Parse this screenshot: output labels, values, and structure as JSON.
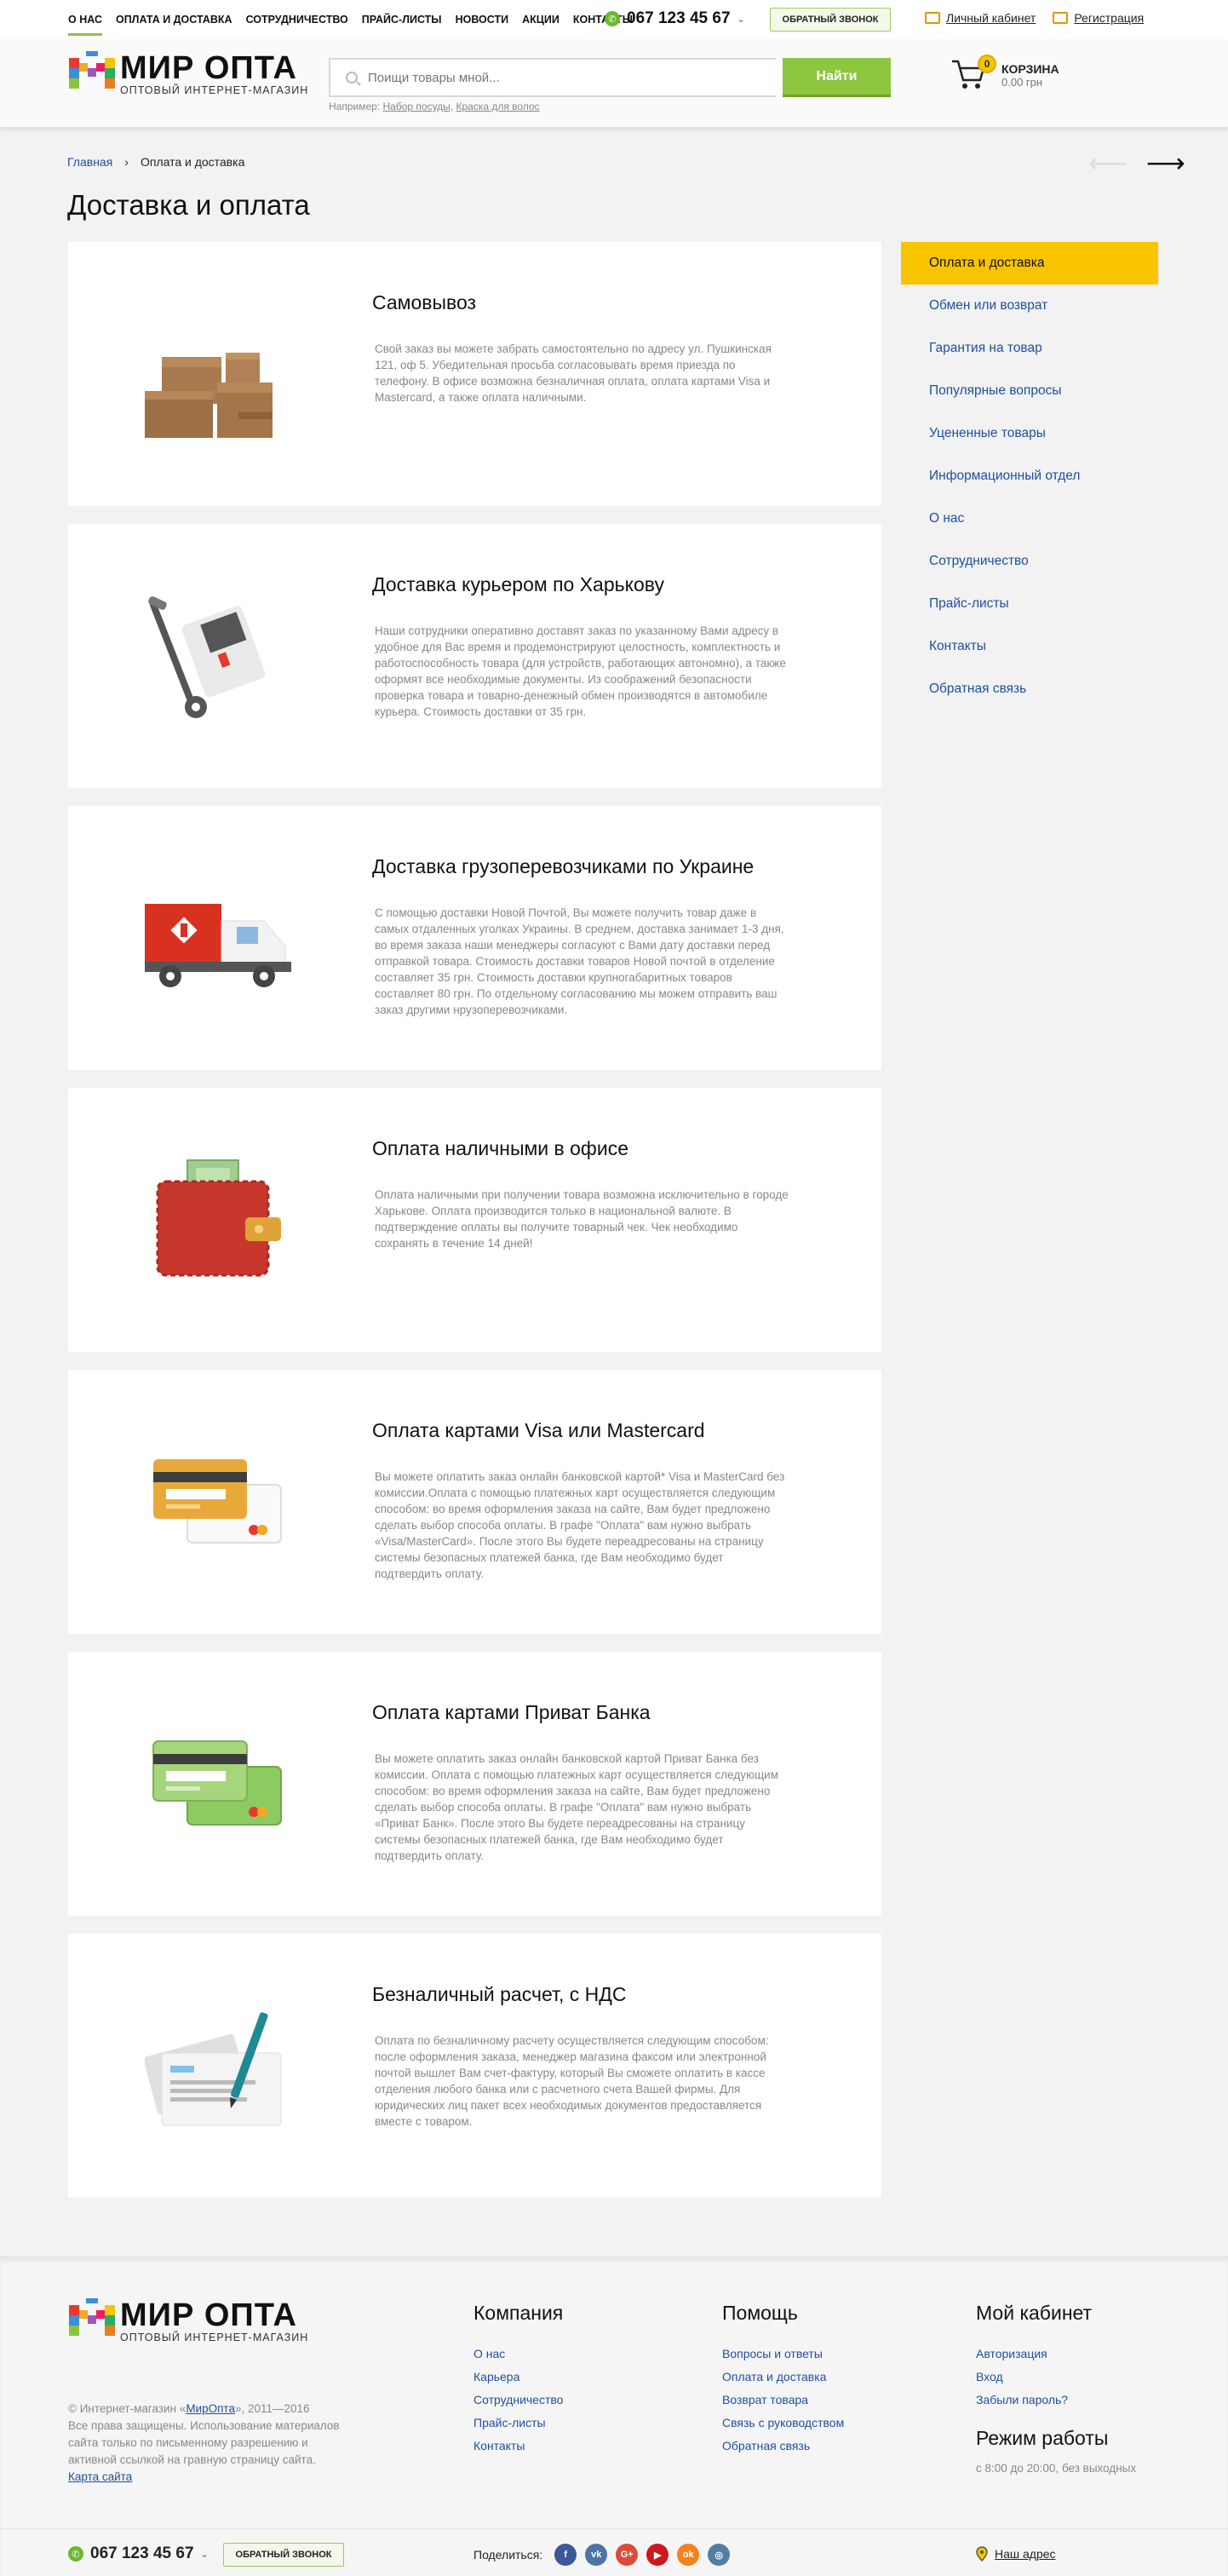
{
  "topnav": {
    "items": [
      "О НАС",
      "ОПЛАТА И ДОСТАВКА",
      "СОТРУДНИЧЕСТВО",
      "ПРАЙС-ЛИСТЫ",
      "НОВОСТИ",
      "АКЦИИ",
      "КОНТАКТЫ"
    ],
    "phone": "067 123 45 67",
    "callback": "ОБРАТНЫЙ ЗВОНОК",
    "account": "Личный кабинет",
    "register": "Регистрация"
  },
  "header": {
    "logo_title": "МИР ОПТА",
    "logo_sub": "ОПТОВЫЙ ИНТЕРНЕТ-МАГАЗИН",
    "search_placeholder": "Поищи товары мной...",
    "search_button": "Найти",
    "example_prefix": "Например:",
    "example_1": "Набор посуды,",
    "example_2": "Краска для волос",
    "cart_count": "0",
    "cart_title": "КОРЗИНА",
    "cart_total": "0.00 грн"
  },
  "breadcrumb": {
    "home": "Главная",
    "sep": "›",
    "current": "Оплата и доставка"
  },
  "pager": {
    "prev": "⟵",
    "next": "⟶"
  },
  "page_title": "Доставка и оплата",
  "cards": [
    {
      "title": "Самовывоз",
      "text": "Свой заказ вы можете забрать самостоятельно по адресу ул. Пушкинская 121, оф 5. Убедительная просьба согласовывать время приезда по телефону. В офисе возможна безналичная оплата, оплата  картами Visa и Mastercard, а также оплата наличными."
    },
    {
      "title": "Доставка курьером по Харькову",
      "text": "Наши сотрудники оперативно доставят заказ по указанному Вами адресу в удобное для Вас время и продемонстрируют целостность, комплектность и работоспособность товара (для устройств, работающих автономно), а также оформят все необходимые документы. Из соображений безопасности проверка товара и товарно-денежный обмен производятся в автомобиле курьера. Стоимость доставки от 35 грн."
    },
    {
      "title": "Доставка грузоперевозчиками по Украине",
      "text": "С помощью доставки Новой Почтой, Вы можете получить товар даже в самых отдаленных уголках Украины. В среднем, доставка занимает 1-3 дня, во время заказа наши менеджеры согласуют с Вами дату доставки перед отправкой товара. Стоимость доставки товаров Новой почтой в отделение составляет 35 грн. Стоимость доставки крупногабаритных товаров составляет 80 грн. По отдельному согласованию мы можем отправить ваш заказ другими нрузоперевозчиками."
    },
    {
      "title": "Оплата наличными в офисе",
      "text": "Оплата наличными при получении товара возможна исключительно в городе Харькове. Оплата производится только в национальной валюте. В подтверждение оплаты вы получите товарный чек. Чек необходимо сохранять в течение 14 дней!"
    },
    {
      "title": "Оплата картами Visa или Mastercard",
      "text": "Вы можете оплатить заказ онлайн банковской картой* Visa и MasterCard без комиссии.Оплата с помощью платежных карт осуществляется следующим способом: во время оформления заказа на сайте, Вам будет предложено сделать выбор способа оплаты. В графе \"Оплата\" вам нужно выбрать «Visa/MasterCard». После этого Вы будете переадресованы на страницу системы безопасных платежей банка, где Вам необходимо будет подтвердить оплату."
    },
    {
      "title": "Оплата картами Приват Банка",
      "text": "Вы можете оплатить заказ онлайн банковской картой Приват Банка без комиссии. Оплата с помощью платежных карт осуществляется следующим способом: во время оформления заказа на сайте, Вам будет предложено сделать выбор способа оплаты. В графе \"Оплата\" вам нужно выбрать «Приват Банк». После этого Вы будете переадресованы на страницу системы безопасных платежей банка, где Вам необходимо будет подтвердить оплату."
    },
    {
      "title": "Безналичный расчет, с НДС",
      "text": "Оплата по безналичному расчету осуществляется следующим способом: после оформления заказа, менеджер магазина факсом или электронной почтой вышлет Вам счет-фактуру, который Вы сможете оплатить в кассе отделения любого банка или с расчетного счета Вашей фирмы. Для юридических лиц пакет всех необходимых документов предоставляется вместе с товаром."
    }
  ],
  "sidebar": [
    "Оплата и доставка",
    "Обмен или возврат",
    "Гарантия на товар",
    "Популярные вопросы",
    "Уцененные товары",
    "Информационный отдел",
    "О нас",
    "Сотрудничество",
    "Прайс-листы",
    "Контакты",
    "Обратная связь"
  ],
  "footer": {
    "copyright_1": "© Интернет-магазин «",
    "copyright_link": "МирОпта",
    "copyright_2": "», 2011—2016",
    "rights": "Все права защищены. Использование материалов сайта только по письменному разрешению и активной ссылкой на гравную страницу сайта.",
    "sitemap": "Карта сайта",
    "company": {
      "title": "Компания",
      "links": [
        "О нас",
        "Карьера",
        "Сотрудничество",
        "Прайс-листы",
        "Контакты"
      ]
    },
    "help": {
      "title": "Помощь",
      "links": [
        "Вопросы и ответы",
        "Оплата и доставка",
        "Возврат товара",
        "Связь с руководством",
        "Обратная связь"
      ]
    },
    "cabinet": {
      "title": "Мой кабинет",
      "links": [
        "Авторизация",
        "Вход",
        "Забыли пароль?"
      ]
    },
    "hours_title": "Режим работы",
    "hours": "с 8:00 до 20:00, без выходных",
    "phone": "067 123 45 67",
    "callback": "ОБРАТНЫЙ ЗВОНОК",
    "share": "Поделиться:",
    "address": "Наш адрес",
    "social": [
      {
        "name": "facebook-icon",
        "glyph": "f",
        "color": "#3b5998"
      },
      {
        "name": "vk-icon",
        "glyph": "vk",
        "color": "#4c75a3"
      },
      {
        "name": "google-plus-icon",
        "glyph": "G+",
        "color": "#dd4b39"
      },
      {
        "name": "youtube-icon",
        "glyph": "▶",
        "color": "#cc181e"
      },
      {
        "name": "odnoklassniki-icon",
        "glyph": "ok",
        "color": "#f58220"
      },
      {
        "name": "instagram-icon",
        "glyph": "◎",
        "color": "#517fa4"
      }
    ]
  }
}
